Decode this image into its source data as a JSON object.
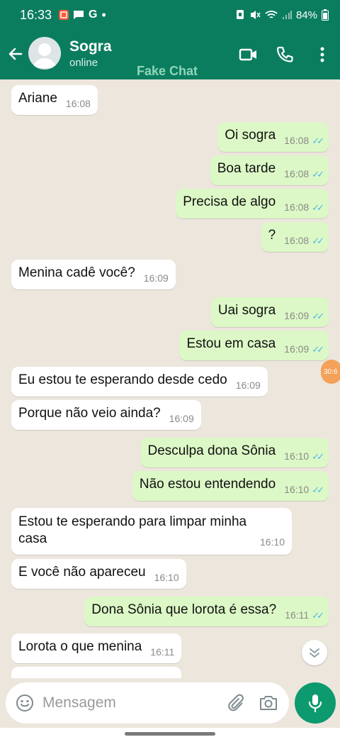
{
  "status": {
    "time": "16:33",
    "battery": "84%",
    "notif_g": "G",
    "dot": "•"
  },
  "header": {
    "name": "Sogra",
    "status": "online",
    "watermark": "Fake Chat"
  },
  "messages": [
    {
      "dir": "in",
      "text": "Ariane",
      "time": "16:08"
    },
    {
      "dir": "out",
      "text": "Oi sogra",
      "time": "16:08"
    },
    {
      "dir": "out",
      "text": "Boa tarde",
      "time": "16:08"
    },
    {
      "dir": "out",
      "text": "Precisa de algo",
      "time": "16:08"
    },
    {
      "dir": "out",
      "text": "?",
      "time": "16:08"
    },
    {
      "dir": "in",
      "text": "Menina cadê você?",
      "time": "16:09"
    },
    {
      "dir": "out",
      "text": "Uai sogra",
      "time": "16:09"
    },
    {
      "dir": "out",
      "text": "Estou em casa",
      "time": "16:09"
    },
    {
      "dir": "in",
      "text": "Eu estou te esperando desde cedo",
      "time": "16:09"
    },
    {
      "dir": "in",
      "text": "Porque não veio ainda?",
      "time": "16:09"
    },
    {
      "dir": "out",
      "text": "Desculpa dona Sônia",
      "time": "16:10"
    },
    {
      "dir": "out",
      "text": "Não estou entendendo",
      "time": "16:10"
    },
    {
      "dir": "in",
      "text": "Estou te esperando para limpar minha casa",
      "time": "16:10"
    },
    {
      "dir": "in",
      "text": "E você não apareceu",
      "time": "16:10"
    },
    {
      "dir": "out",
      "text": "Dona Sônia que lorota é essa?",
      "time": "16:11"
    },
    {
      "dir": "in",
      "text": "Lorota o que menina",
      "time": "16:11"
    }
  ],
  "side_badge": "30:6",
  "composer": {
    "placeholder": "Mensagem"
  },
  "icons": {
    "back": "arrow-left-icon",
    "video": "video-camera-icon",
    "call": "phone-icon",
    "menu": "more-vert-icon",
    "emoji": "emoji-icon",
    "attach": "paperclip-icon",
    "camera": "camera-icon",
    "mic": "microphone-icon",
    "scroll": "chevron-double-down-icon"
  },
  "colors": {
    "header": "#0b7d5f",
    "outgoing": "#dcf8c6",
    "incoming": "#ffffff",
    "read_ticks": "#4fb6ec",
    "mic": "#0c9a6e"
  }
}
